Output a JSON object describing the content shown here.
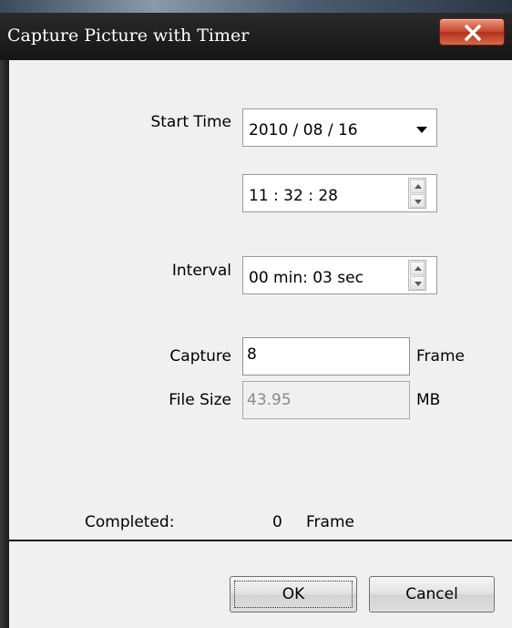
{
  "window": {
    "title": "Capture Picture with Timer",
    "close_icon": "close-icon"
  },
  "form": {
    "start_time_label": "Start Time",
    "date_value": "2010 / 08 / 16",
    "time_value": "11 : 32 : 28",
    "interval_label": "Interval",
    "interval_value": "00 min: 03 sec",
    "capture_label": "Capture",
    "capture_value": "8",
    "capture_unit": "Frame",
    "filesize_label": "File Size",
    "filesize_value": "43.95",
    "filesize_unit": "MB"
  },
  "status": {
    "completed_label": "Completed:",
    "completed_count": "0",
    "completed_unit": "Frame"
  },
  "buttons": {
    "ok_label": "OK",
    "cancel_label": "Cancel"
  },
  "colors": {
    "titlebar": "#1c1c1c",
    "close_button": "#c7462f",
    "dialog_background": "#f0f0f0"
  }
}
